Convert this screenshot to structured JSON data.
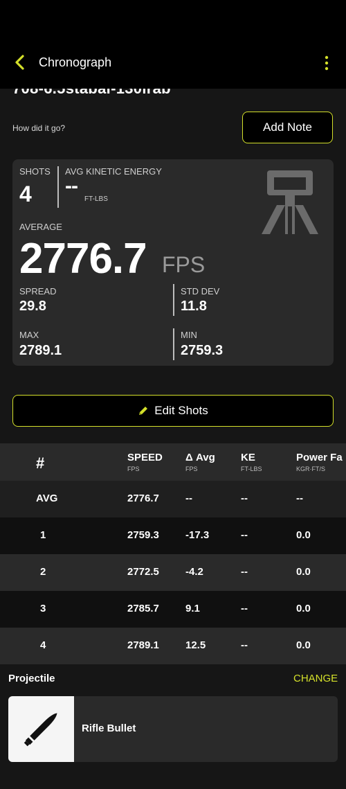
{
  "header": {
    "title": "Chronograph",
    "icons": {
      "back": "chevron-left-icon",
      "menu": "more-vertical-icon"
    },
    "accent_color": "#d4e02a"
  },
  "session": {
    "name_partial": "708-6.5stabal-130lrab",
    "prompt": "How did it go?",
    "add_note_label": "Add Note"
  },
  "stats": {
    "shots_label": "SHOTS",
    "shots_value": "4",
    "ke_label": "AVG KINETIC ENERGY",
    "ke_value": "--",
    "ke_unit": "FT-LBS",
    "average_label": "AVERAGE",
    "average_value": "2776.7",
    "average_unit": "FPS",
    "spread_label": "SPREAD",
    "spread_value": "29.8",
    "std_label": "STD DEV",
    "std_value": "11.8",
    "max_label": "MAX",
    "max_value": "2789.1",
    "min_label": "MIN",
    "min_value": "2759.3",
    "device_icon": "chronograph-tripod-icon"
  },
  "edit_shots_label": "Edit Shots",
  "table": {
    "headers": [
      {
        "label": "#",
        "sub": ""
      },
      {
        "label": "SPEED",
        "sub": "FPS"
      },
      {
        "label": "Δ Avg",
        "sub": "FPS"
      },
      {
        "label": "KE",
        "sub": "FT-LBS"
      },
      {
        "label": "Power Fa",
        "sub": "KGR·FT/S"
      }
    ],
    "rows": [
      [
        "AVG",
        "2776.7",
        "--",
        "--",
        "--"
      ],
      [
        "1",
        "2759.3",
        "-17.3",
        "--",
        "0.0"
      ],
      [
        "2",
        "2772.5",
        "-4.2",
        "--",
        "0.0"
      ],
      [
        "3",
        "2785.7",
        "9.1",
        "--",
        "0.0"
      ],
      [
        "4",
        "2789.1",
        "12.5",
        "--",
        "0.0"
      ]
    ]
  },
  "projectile": {
    "title": "Projectile",
    "change_label": "CHANGE",
    "name": "Rifle Bullet",
    "icon": "bullet-icon"
  }
}
